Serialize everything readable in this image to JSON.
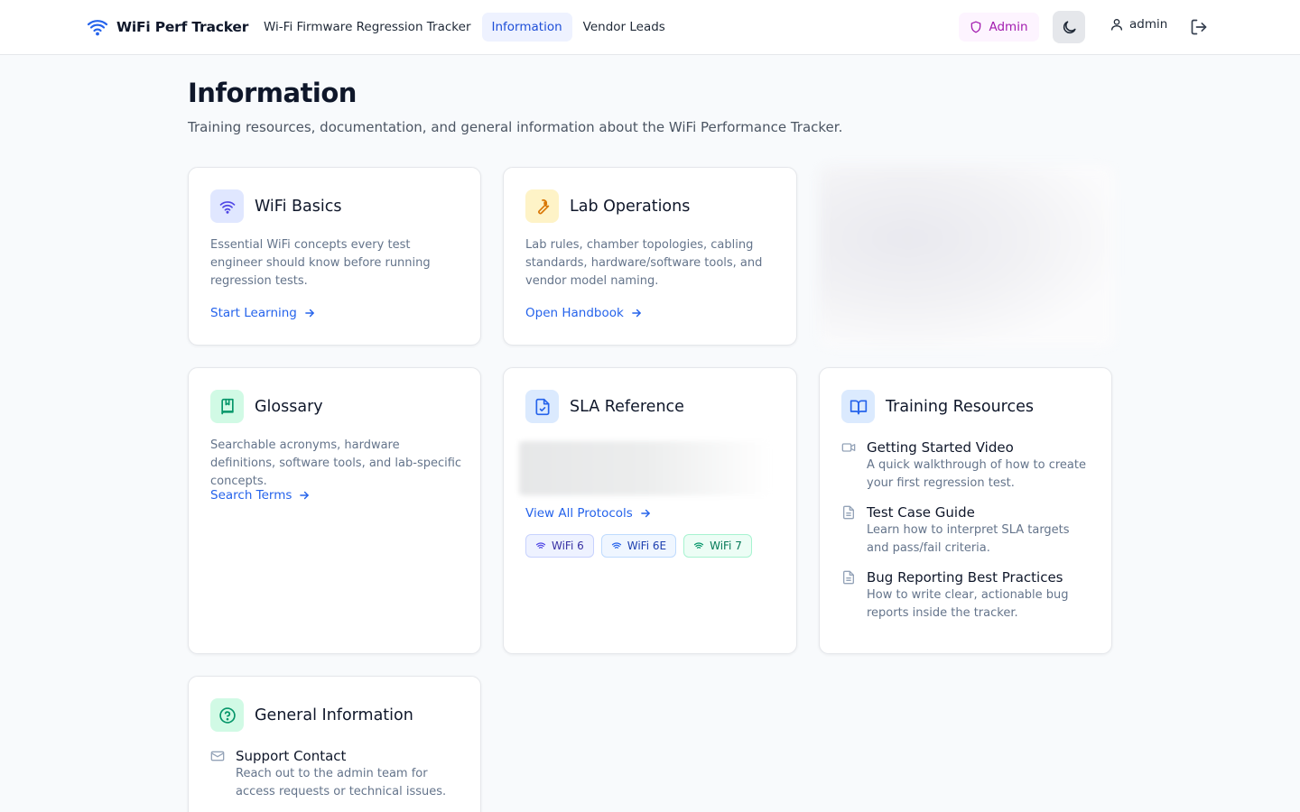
{
  "header": {
    "app_name": "WiFi Perf Tracker",
    "tabs": [
      {
        "label": "Wi-Fi Firmware Regression Tracker",
        "active": false
      },
      {
        "label": "Information",
        "active": true
      },
      {
        "label": "Vendor Leads",
        "active": false
      }
    ],
    "admin_badge": "Admin",
    "username": "admin"
  },
  "page": {
    "title": "Information",
    "subtitle": "Training resources, documentation, and general information about the WiFi Performance Tracker."
  },
  "cards": {
    "wifi_basics": {
      "title": "WiFi Basics",
      "description": "Essential WiFi concepts every test engineer should know before running regression tests.",
      "link": "Start Learning"
    },
    "lab_operations": {
      "title": "Lab Operations",
      "description": "Lab rules, chamber topologies, cabling standards, hardware/software tools, and vendor model naming.",
      "link": "Open Handbook"
    },
    "glossary": {
      "title": "Glossary",
      "description": "Searchable acronyms, hardware definitions, software tools, and lab-specific concepts.",
      "link": "Search Terms"
    },
    "sla_reference": {
      "title": "SLA Reference",
      "link": "View All Protocols",
      "chips": [
        "WiFi 6",
        "WiFi 6E",
        "WiFi 7"
      ]
    },
    "training_resources": {
      "title": "Training Resources",
      "items": [
        {
          "icon": "video-icon",
          "title": "Getting Started Video",
          "description": "A quick walkthrough of how to create your first regression test."
        },
        {
          "icon": "document-icon",
          "title": "Test Case Guide",
          "description": "Learn how to interpret SLA targets and pass/fail criteria."
        },
        {
          "icon": "document-icon",
          "title": "Bug Reporting Best Practices",
          "description": "How to write clear, actionable bug reports inside the tracker."
        }
      ]
    },
    "general_information": {
      "title": "General Information",
      "items": [
        {
          "icon": "mail-icon",
          "title": "Support Contact",
          "description": "Reach out to the admin team for access requests or technical issues."
        }
      ]
    }
  },
  "colors": {
    "accent": "#2563eb",
    "admin": "#a21caf",
    "page_bg": "#f8fafc"
  }
}
